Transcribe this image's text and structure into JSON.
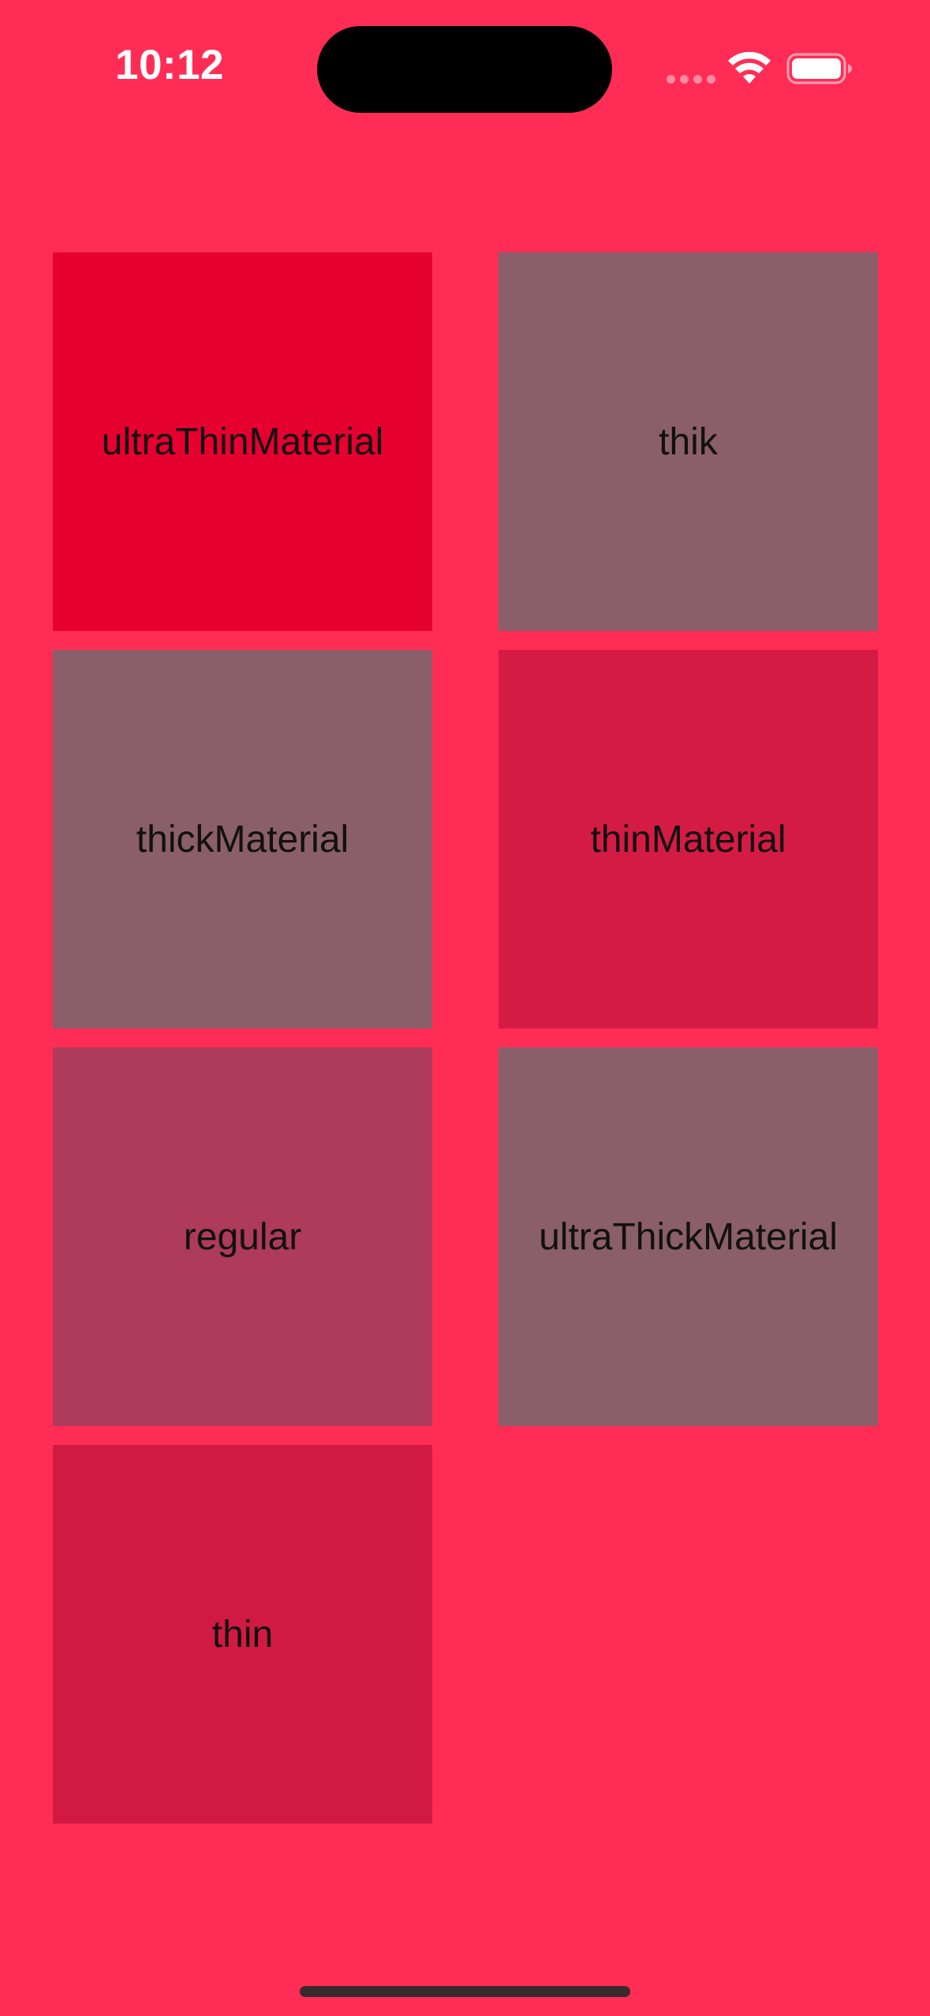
{
  "status_bar": {
    "time": "10:12",
    "icons": [
      "signal-dots-icon",
      "wifi-icon",
      "battery-icon"
    ]
  },
  "tiles": [
    {
      "label": "ultraThinMaterial",
      "color": "#e6002f"
    },
    {
      "label": "thik",
      "color": "#8a5e6a"
    },
    {
      "label": "thickMaterial",
      "color": "#8a5e6a"
    },
    {
      "label": "thinMaterial",
      "color": "#d41b44"
    },
    {
      "label": "regular",
      "color": "#ad3b59"
    },
    {
      "label": "ultraThickMaterial",
      "color": "#8a5e6a"
    },
    {
      "label": "thin",
      "color": "#d01a42"
    }
  ],
  "colors": {
    "background": "#ff2d55",
    "status_text": "#ffffff",
    "home_indicator": "#3a2a2e"
  }
}
